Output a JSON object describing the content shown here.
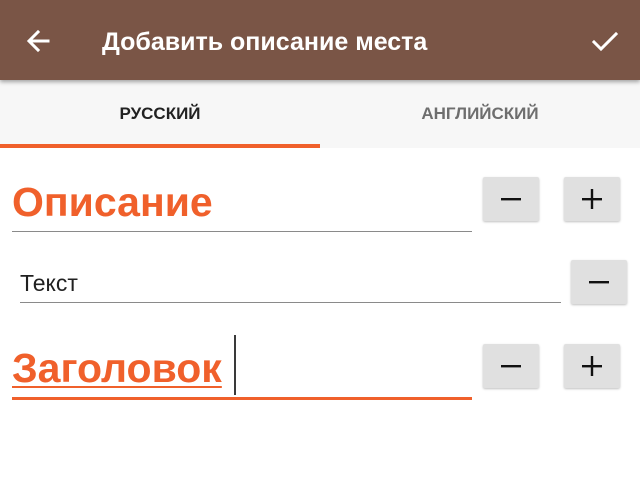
{
  "toolbar": {
    "title": "Добавить описание места",
    "back_icon": "arrow-left-icon",
    "confirm_icon": "check-icon",
    "background_color": "#7a5546"
  },
  "tabs": [
    {
      "label": "РУССКИЙ",
      "selected": true
    },
    {
      "label": "АНГЛИЙСКИЙ",
      "selected": false
    }
  ],
  "accent_color": "#f0602b",
  "sections": {
    "description": {
      "title": "Описание",
      "remove_icon": "minus-icon",
      "add_icon": "plus-icon"
    },
    "text_item": {
      "value": "Текст",
      "remove_icon": "minus-icon"
    },
    "heading": {
      "title": "Заголовок",
      "focused": true,
      "remove_icon": "minus-icon",
      "add_icon": "plus-icon"
    }
  }
}
